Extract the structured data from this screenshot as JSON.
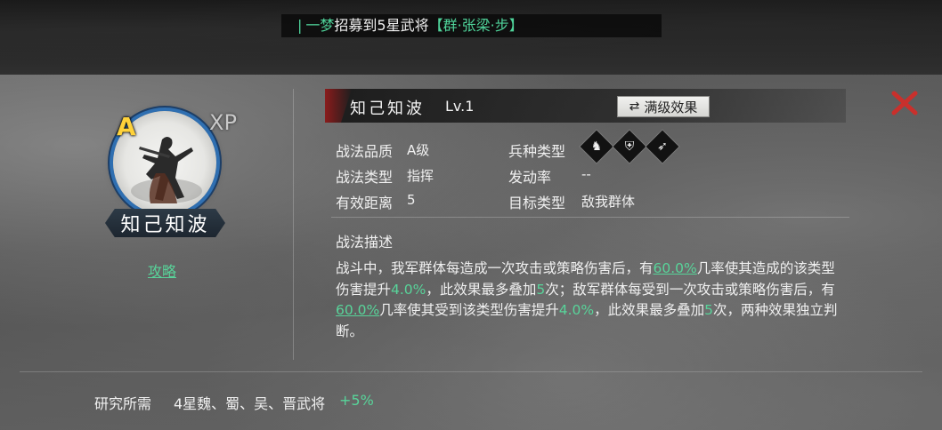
{
  "notice": {
    "bar": "|",
    "player": "一梦",
    "text": "招募到5星武将",
    "hero": "【群·张梁·步】"
  },
  "skill": {
    "grade": "A",
    "xp_label": "XP",
    "name": "知己知波",
    "plate_name": "知己知波",
    "level": "Lv.1",
    "max_effect_button": "满级效果",
    "strategy_link": "攻略"
  },
  "info": {
    "quality_label": "战法品质",
    "quality_value": "A级",
    "type_label": "战法类型",
    "type_value": "指挥",
    "range_label": "有效距离",
    "range_value": "5",
    "troop_label": "兵种类型",
    "troop_icons": [
      "cavalry-icon",
      "shield-icon",
      "bow-icon"
    ],
    "trigger_label": "发动率",
    "trigger_value": "--",
    "target_label": "目标类型",
    "target_value": "敌我群体"
  },
  "description": {
    "title": "战法描述",
    "p1": "战斗中，我军群体每造成一次攻击或策略伤害后，有",
    "v1": "60.0%",
    "p2": "几率使其造成的该类型伤害提升",
    "v2": "4.0%",
    "p3": "，此效果最多叠加",
    "v3": "5",
    "p4": "次；敌军群体每受到一次攻击或策略伤害后，有",
    "v4": "60.0%",
    "p5": "几率使其受到该类型伤害提升",
    "v5": "4.0%",
    "p6": "，此效果最多叠加",
    "v6": "5",
    "p7": "次，两种效果独立判断。"
  },
  "research": {
    "label": "研究所需",
    "value": "4星魏、蜀、吴、晋武将",
    "bonus": "+5%"
  },
  "colors": {
    "accent_green": "#58d49a",
    "grade_gold": "#ffd23a",
    "close_red": "#c9302c",
    "ring_blue": "#2f6fb1"
  }
}
